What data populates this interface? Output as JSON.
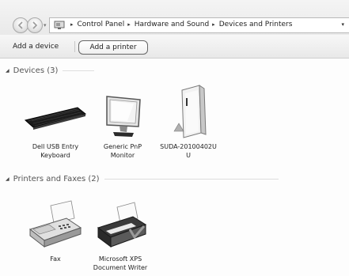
{
  "breadcrumb": {
    "items": [
      {
        "label": "Control Panel"
      },
      {
        "label": "Hardware and Sound"
      },
      {
        "label": "Devices and Printers"
      }
    ],
    "separator": "▸",
    "dropdown": "▾"
  },
  "nav": {
    "dropdown": "▾"
  },
  "toolbar": {
    "add_device_label": "Add a device",
    "add_printer_label": "Add a printer"
  },
  "groups": {
    "devices": {
      "title": "Devices (3)",
      "collapse_glyph": "◢",
      "items": [
        {
          "label_line1": "Dell USB Entry",
          "label_line2": "Keyboard",
          "icon": "keyboard-icon"
        },
        {
          "label_line1": "Generic PnP",
          "label_line2": "Monitor",
          "icon": "monitor-icon"
        },
        {
          "label_line1": "SUDA-20100402U",
          "label_line2": "U",
          "icon": "computer-tower-icon"
        }
      ]
    },
    "printers": {
      "title": "Printers and Faxes (2)",
      "collapse_glyph": "◢",
      "items": [
        {
          "label_line1": "Fax",
          "label_line2": "",
          "icon": "fax-icon"
        },
        {
          "label_line1": "Microsoft XPS",
          "label_line2": "Document Writer",
          "icon": "printer-icon"
        }
      ]
    }
  }
}
